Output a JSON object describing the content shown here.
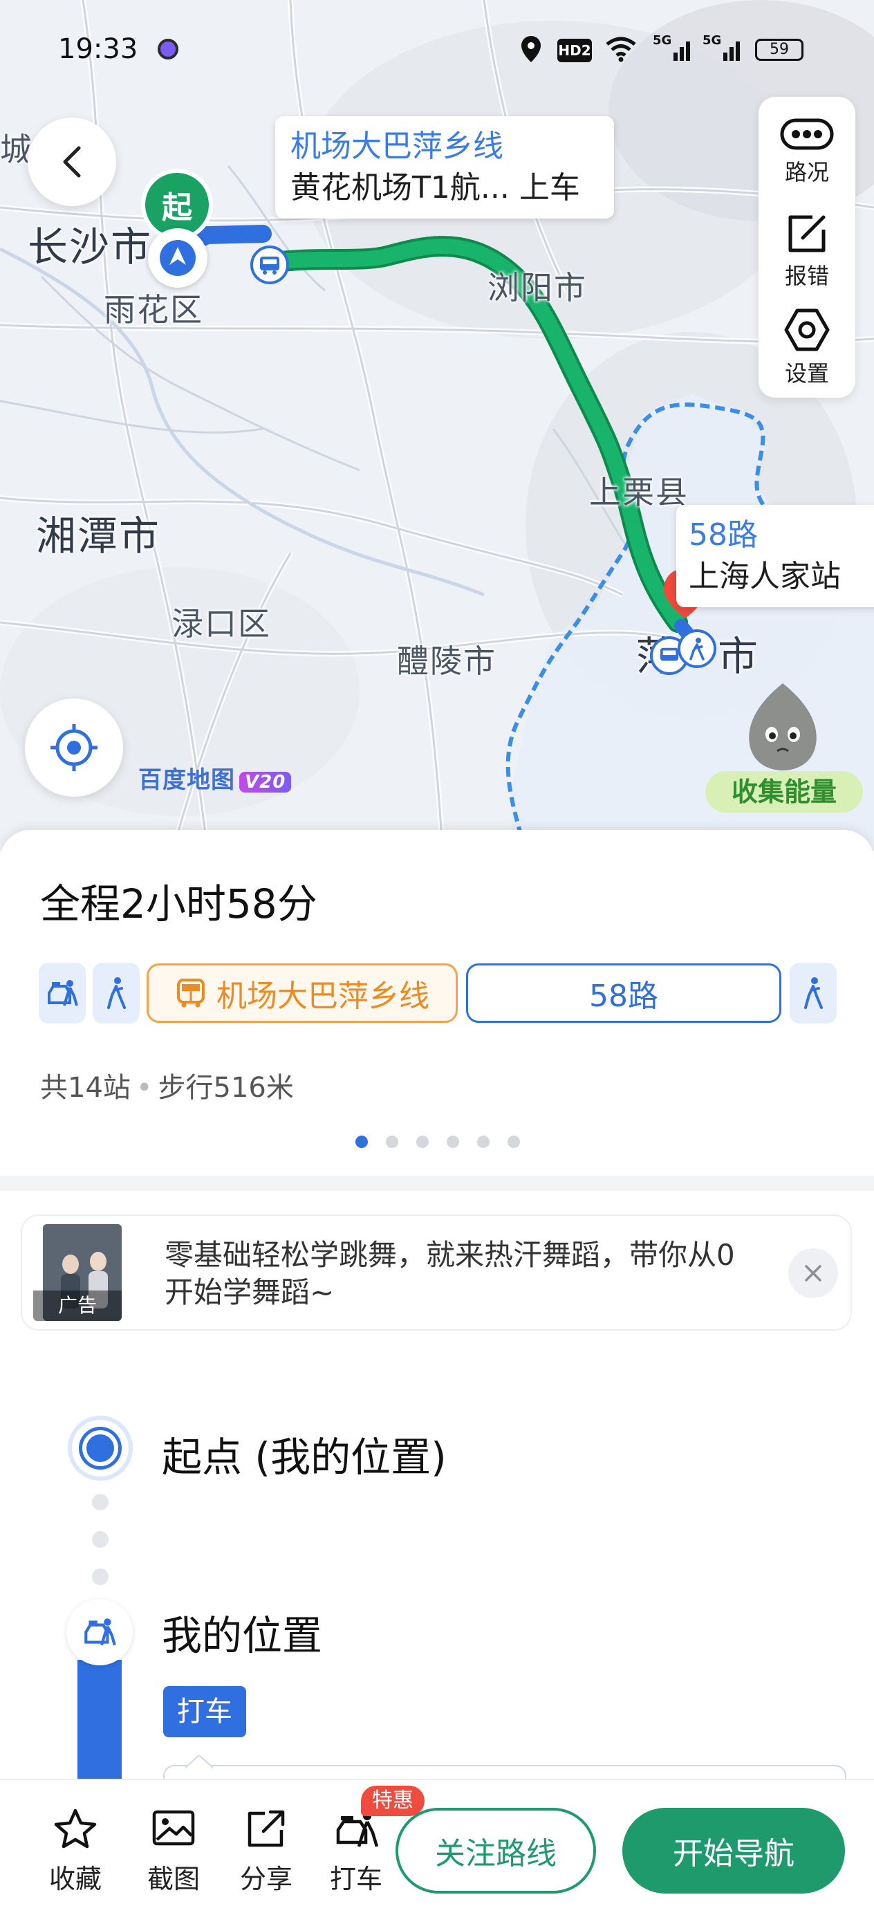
{
  "status_bar": {
    "time": "19:33",
    "battery": "59",
    "network_1": "5G",
    "network_2": "5G",
    "hd_badge": "HD2"
  },
  "map": {
    "labels": {
      "cheng": "城",
      "changsha": "长沙市",
      "yuhua": "雨花区",
      "liuyang": "浏阳市",
      "shangli": "上栗县",
      "xiangtan": "湘潭市",
      "lukou": "渌口区",
      "liling": "醴陵市",
      "ping": "萍",
      "shi": "市"
    },
    "start_marker": "起",
    "callout_bus": {
      "line": "机场大巴萍乡线",
      "stop": "黄花机场T1航... 上车"
    },
    "callout_58": {
      "line": "58路",
      "stop": "上海人家站"
    },
    "tools": [
      {
        "label": "路况",
        "icon": "traffic-icon"
      },
      {
        "label": "报错",
        "icon": "report-error-icon"
      },
      {
        "label": "设置",
        "icon": "settings-icon"
      }
    ],
    "logo": "百度地图",
    "version": "V20",
    "energy_label": "收集能量"
  },
  "route": {
    "total_time": "全程2小时58分",
    "segments": [
      {
        "type": "taxi",
        "icon": "taxi-icon"
      },
      {
        "type": "walk",
        "icon": "walk-icon"
      },
      {
        "type": "bus",
        "label": "机场大巴萍乡线",
        "icon": "bus-icon"
      },
      {
        "type": "bus",
        "label": "58路"
      },
      {
        "type": "walk",
        "icon": "walk-icon"
      }
    ],
    "stops": "共14站",
    "walk": "步行516米",
    "page_count": 6,
    "active_page": 1
  },
  "ad": {
    "text": "零基础轻松学跳舞，就来热汗舞蹈，带你从0开始学舞蹈~",
    "tag": "广告"
  },
  "timeline": {
    "start_label": "起点 (我的位置)",
    "my_position": "我的位置",
    "taxi_chip": "打车"
  },
  "bottom_bar": {
    "items": [
      {
        "label": "收藏",
        "icon": "star-icon"
      },
      {
        "label": "截图",
        "icon": "screenshot-icon"
      },
      {
        "label": "分享",
        "icon": "share-icon"
      },
      {
        "label": "打车",
        "icon": "taxi-icon"
      }
    ],
    "taxi_badge": "特惠",
    "follow_label": "关注路线",
    "navigate_label": "开始导航"
  },
  "colors": {
    "route_green": "#19b46c",
    "accent_blue": "#2f6fe0",
    "bus_orange": "#ee8a1f",
    "nav_green": "#1e9a6d",
    "boundary_blue": "#3b8ee8"
  }
}
